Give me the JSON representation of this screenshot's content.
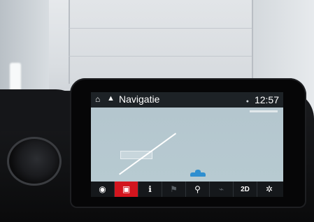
{
  "scene": {
    "description_icons": [
      "garage-door",
      "dashboard-air-vent"
    ]
  },
  "status_bar": {
    "title": "Navigatie",
    "time": "12:57"
  },
  "map": {
    "background_color": "#b5c8cf",
    "road_color": "#ffffff",
    "vehicle_color": "#2f8fd0"
  },
  "toolbar": {
    "active_color": "#d3151e",
    "items": [
      {
        "name": "compass",
        "glyph": "◉"
      },
      {
        "name": "map-view",
        "glyph": "▣"
      },
      {
        "name": "info",
        "glyph": "ℹ"
      },
      {
        "name": "route",
        "glyph": "⚑"
      },
      {
        "name": "location",
        "glyph": "⚲"
      },
      {
        "name": "traffic",
        "glyph": "⌁"
      },
      {
        "name": "view-mode",
        "label": "2D"
      },
      {
        "name": "settings",
        "glyph": "✲"
      }
    ]
  }
}
